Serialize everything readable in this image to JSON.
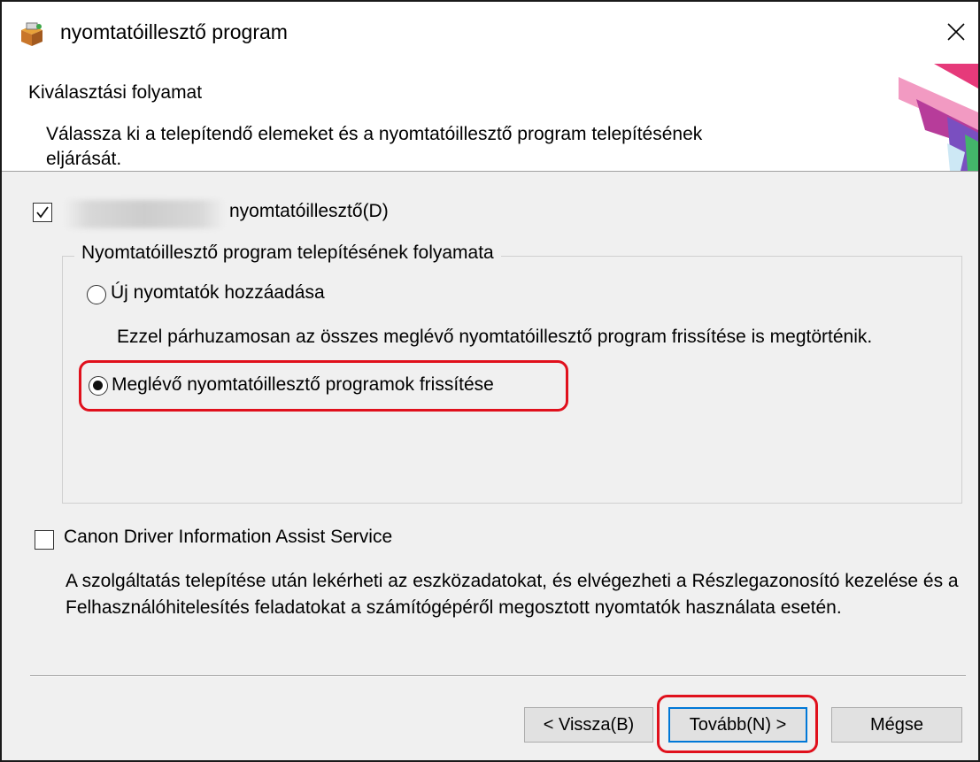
{
  "window": {
    "title": "nyomtatóillesztő program"
  },
  "header": {
    "heading": "Kiválasztási folyamat",
    "description": "Válassza ki a telepítendő elemeket és a nyomtatóillesztő program telepítésének eljárását."
  },
  "driver_option": {
    "label": "nyomtatóillesztő(D)",
    "checked": true
  },
  "install_group": {
    "legend": "Nyomtatóillesztő program telepítésének folyamata",
    "options": [
      {
        "label": "Új nyomtatók hozzáadása",
        "description": "Ezzel párhuzamosan az összes meglévő nyomtatóillesztő program frissítése is megtörténik.",
        "selected": false
      },
      {
        "label": "Meglévő nyomtatóillesztő programok frissítése",
        "selected": true
      }
    ]
  },
  "service_option": {
    "label": "Canon Driver Information Assist Service",
    "checked": false,
    "description": "A szolgáltatás telepítése után lekérheti az eszközadatokat, és elvégezheti a Részlegazonosító kezelése és a Felhasználóhitelesítés feladatokat a számítógépéről megosztott nyomtatók használata esetén."
  },
  "buttons": {
    "back": "< Vissza(B)",
    "next": "Tovább(N) >",
    "cancel": "Mégse"
  },
  "colors": {
    "highlight": "#e0101c",
    "focus": "#0078d7",
    "dialog_bg": "#f0f0f0"
  },
  "icons": {
    "app": "printer-box-icon",
    "close": "close-icon"
  }
}
